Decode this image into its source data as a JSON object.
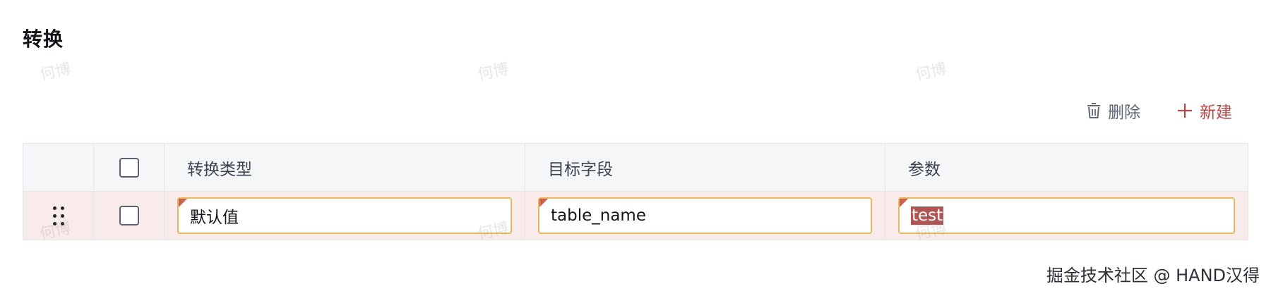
{
  "section": {
    "title": "转换"
  },
  "watermark": {
    "text": "何博"
  },
  "toolbar": {
    "delete_label": "删除",
    "add_label": "新建",
    "delete_icon": "trash-icon",
    "add_icon": "plus-icon"
  },
  "table": {
    "columns": [
      "转换类型",
      "目标字段",
      "参数"
    ],
    "rows": [
      {
        "transform_type": "默认值",
        "target_field": "table_name",
        "params": "test"
      }
    ]
  },
  "credit": {
    "text": "掘金技术社区 @ HAND汉得"
  },
  "colors": {
    "accent": "#b04a4a",
    "row_highlight": "#f9ebea",
    "input_border": "#e8b95c",
    "dirty_marker": "#c9624f"
  }
}
